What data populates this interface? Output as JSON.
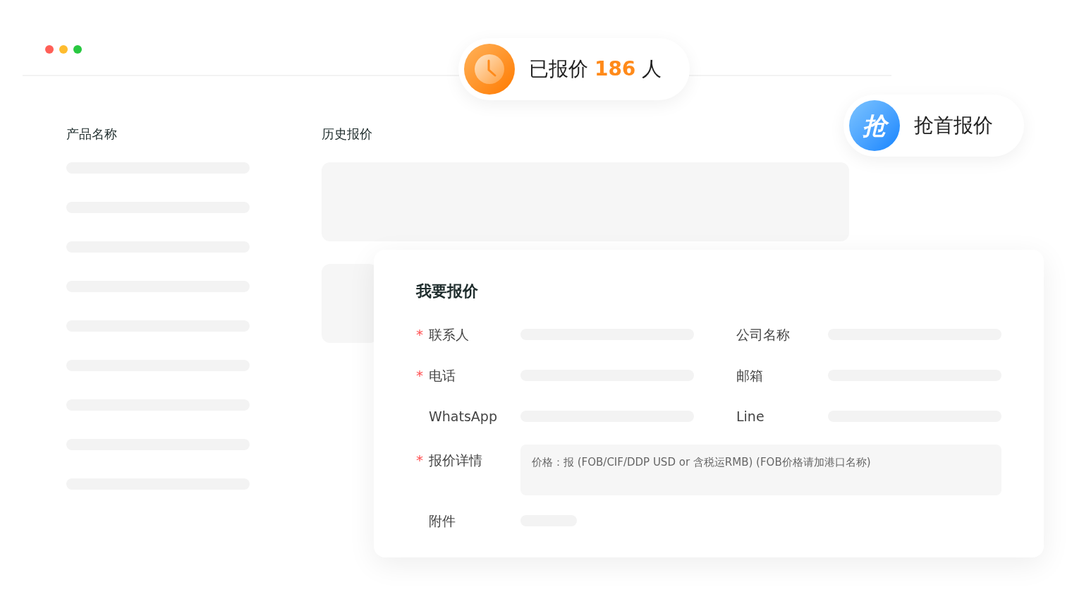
{
  "window_dots": [
    {
      "color": "#ff5f57"
    },
    {
      "color": "#febc2e"
    },
    {
      "color": "#28c840"
    }
  ],
  "quote_count_badge": {
    "prefix": "已报价",
    "count": "186",
    "suffix": "人"
  },
  "first_quote_badge": {
    "icon_char": "抢",
    "label": "抢首报价"
  },
  "product_column": {
    "title": "产品名称"
  },
  "history_column": {
    "title": "历史报价"
  },
  "quote_form": {
    "title": "我要报价",
    "required_symbol": "*",
    "rows": [
      [
        {
          "label": "联系人",
          "required": true
        },
        {
          "label": "公司名称",
          "required": false
        }
      ],
      [
        {
          "label": "电话",
          "required": true
        },
        {
          "label": "邮箱",
          "required": false
        }
      ],
      [
        {
          "label": "WhatsApp",
          "required": false
        },
        {
          "label": "Line",
          "required": false
        }
      ]
    ],
    "details": {
      "label": "报价详情",
      "required": true,
      "placeholder": "价格：报 (FOB/CIF/DDP USD or 含税运RMB) (FOB价格请加港口名称)"
    },
    "attachment": {
      "label": "附件",
      "required": false
    }
  }
}
